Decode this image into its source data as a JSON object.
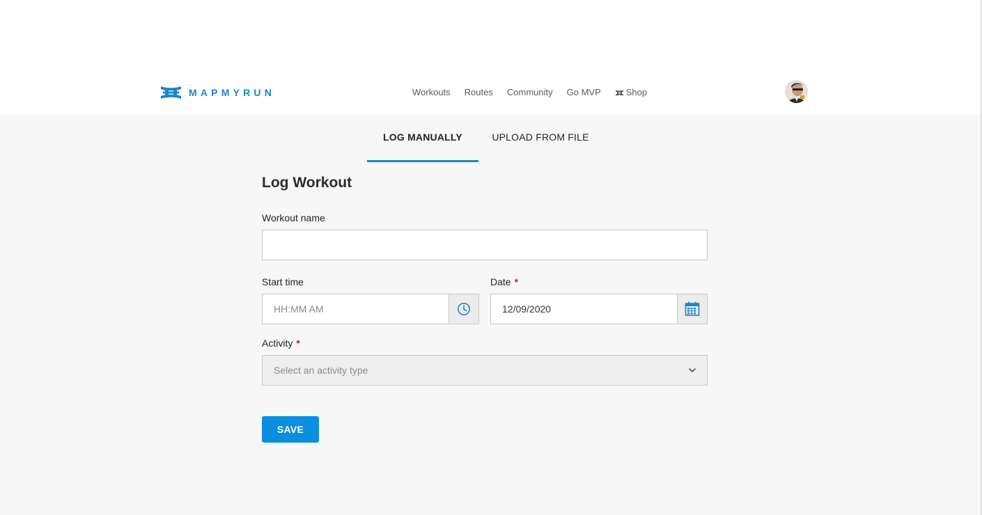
{
  "brand": {
    "name": "MAPMYRUN",
    "color": "#1a86c7"
  },
  "nav": {
    "items": [
      {
        "label": "Workouts"
      },
      {
        "label": "Routes"
      },
      {
        "label": "Community"
      },
      {
        "label": "Go MVP"
      },
      {
        "label": "Shop",
        "icon": "under-armour-icon"
      }
    ]
  },
  "tabs": [
    {
      "label": "LOG MANUALLY",
      "active": true
    },
    {
      "label": "UPLOAD FROM FILE",
      "active": false
    }
  ],
  "form": {
    "title": "Log Workout",
    "workout_name": {
      "label": "Workout name",
      "value": ""
    },
    "start_time": {
      "label": "Start time",
      "placeholder": "HH:MM AM",
      "icon": "clock-icon"
    },
    "date": {
      "label": "Date",
      "required_mark": "*",
      "value": "12/09/2020",
      "icon": "calendar-icon"
    },
    "activity": {
      "label": "Activity",
      "required_mark": "*",
      "placeholder": "Select an activity type"
    },
    "save_label": "SAVE"
  },
  "colors": {
    "accent": "#1a86c7",
    "button": "#0a8fe0",
    "required": "#cc1f1f",
    "background": "#f7f7f7"
  }
}
